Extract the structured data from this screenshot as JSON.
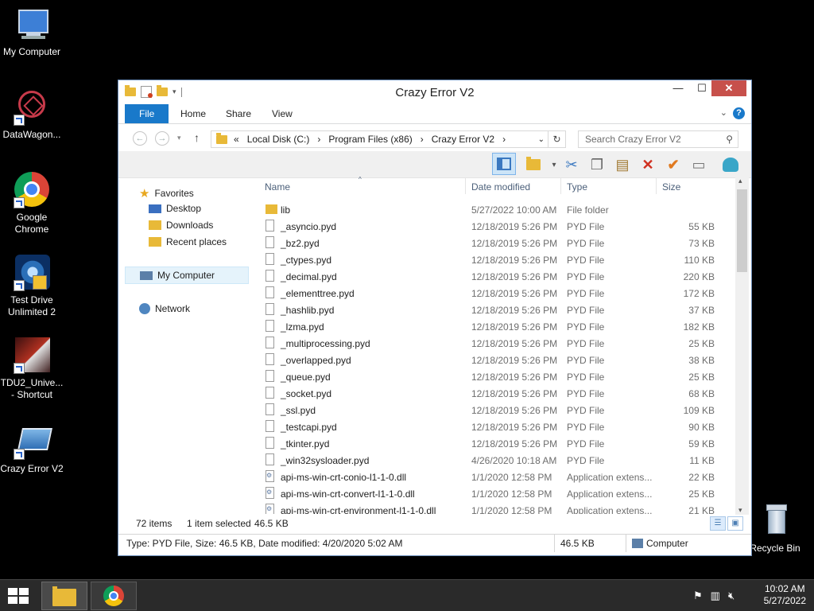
{
  "desktop": {
    "icons": [
      {
        "label": "My Computer"
      },
      {
        "label": "DataWagon..."
      },
      {
        "label": "Google Chrome"
      },
      {
        "label": "Test Drive Unlimited 2"
      },
      {
        "label": "TDU2_Unive... - Shortcut"
      },
      {
        "label": "Crazy Error V2"
      },
      {
        "label": "Recycle Bin"
      }
    ]
  },
  "window": {
    "title": "Crazy Error V2",
    "controls": {
      "minimize": "—",
      "maximize": "☐",
      "close": "✕"
    },
    "ribbon_tabs": [
      "File",
      "Home",
      "Share",
      "View"
    ],
    "help": "?",
    "address": {
      "prefix": "«",
      "segments": [
        "Local Disk (C:)",
        "Program Files (x86)",
        "Crazy Error V2"
      ],
      "separator": "›"
    },
    "search_placeholder": "Search Crazy Error V2",
    "nav": {
      "favorites": "Favorites",
      "desktop": "Desktop",
      "downloads": "Downloads",
      "recent": "Recent places",
      "computer": "My Computer",
      "network": "Network"
    },
    "columns": {
      "name": "Name",
      "date": "Date modified",
      "type": "Type",
      "size": "Size"
    },
    "files": [
      {
        "name": "lib",
        "date": "5/27/2022 10:00 AM",
        "type": "File folder",
        "size": "",
        "kind": "folder"
      },
      {
        "name": "_asyncio.pyd",
        "date": "12/18/2019 5:26 PM",
        "type": "PYD File",
        "size": "55 KB",
        "kind": "file"
      },
      {
        "name": "_bz2.pyd",
        "date": "12/18/2019 5:26 PM",
        "type": "PYD File",
        "size": "73 KB",
        "kind": "file"
      },
      {
        "name": "_ctypes.pyd",
        "date": "12/18/2019 5:26 PM",
        "type": "PYD File",
        "size": "110 KB",
        "kind": "file"
      },
      {
        "name": "_decimal.pyd",
        "date": "12/18/2019 5:26 PM",
        "type": "PYD File",
        "size": "220 KB",
        "kind": "file"
      },
      {
        "name": "_elementtree.pyd",
        "date": "12/18/2019 5:26 PM",
        "type": "PYD File",
        "size": "172 KB",
        "kind": "file"
      },
      {
        "name": "_hashlib.pyd",
        "date": "12/18/2019 5:26 PM",
        "type": "PYD File",
        "size": "37 KB",
        "kind": "file"
      },
      {
        "name": "_lzma.pyd",
        "date": "12/18/2019 5:26 PM",
        "type": "PYD File",
        "size": "182 KB",
        "kind": "file"
      },
      {
        "name": "_multiprocessing.pyd",
        "date": "12/18/2019 5:26 PM",
        "type": "PYD File",
        "size": "25 KB",
        "kind": "file"
      },
      {
        "name": "_overlapped.pyd",
        "date": "12/18/2019 5:26 PM",
        "type": "PYD File",
        "size": "38 KB",
        "kind": "file"
      },
      {
        "name": "_queue.pyd",
        "date": "12/18/2019 5:26 PM",
        "type": "PYD File",
        "size": "25 KB",
        "kind": "file"
      },
      {
        "name": "_socket.pyd",
        "date": "12/18/2019 5:26 PM",
        "type": "PYD File",
        "size": "68 KB",
        "kind": "file"
      },
      {
        "name": "_ssl.pyd",
        "date": "12/18/2019 5:26 PM",
        "type": "PYD File",
        "size": "109 KB",
        "kind": "file"
      },
      {
        "name": "_testcapi.pyd",
        "date": "12/18/2019 5:26 PM",
        "type": "PYD File",
        "size": "90 KB",
        "kind": "file"
      },
      {
        "name": "_tkinter.pyd",
        "date": "12/18/2019 5:26 PM",
        "type": "PYD File",
        "size": "59 KB",
        "kind": "file"
      },
      {
        "name": "_win32sysloader.pyd",
        "date": "4/26/2020 10:18 AM",
        "type": "PYD File",
        "size": "11 KB",
        "kind": "file"
      },
      {
        "name": "api-ms-win-crt-conio-l1-1-0.dll",
        "date": "1/1/2020 12:58 PM",
        "type": "Application extens...",
        "size": "22 KB",
        "kind": "dll"
      },
      {
        "name": "api-ms-win-crt-convert-l1-1-0.dll",
        "date": "1/1/2020 12:58 PM",
        "type": "Application extens...",
        "size": "25 KB",
        "kind": "dll"
      },
      {
        "name": "api-ms-win-crt-environment-l1-1-0.dll",
        "date": "1/1/2020 12:58 PM",
        "type": "Application extens...",
        "size": "21 KB",
        "kind": "dll"
      }
    ],
    "status": {
      "count": "72 items",
      "selected": "1 item selected",
      "selected_size": "46.5 KB"
    },
    "details": {
      "info": "Type: PYD File, Size: 46.5 KB, Date modified: 4/20/2020 5:02 AM",
      "size": "46.5 KB",
      "location": "Computer"
    }
  },
  "taskbar": {
    "time": "10:02 AM",
    "date": "5/27/2022"
  },
  "colors": {
    "accent": "#1979ca",
    "close": "#c7504b",
    "folder": "#e8b938"
  }
}
